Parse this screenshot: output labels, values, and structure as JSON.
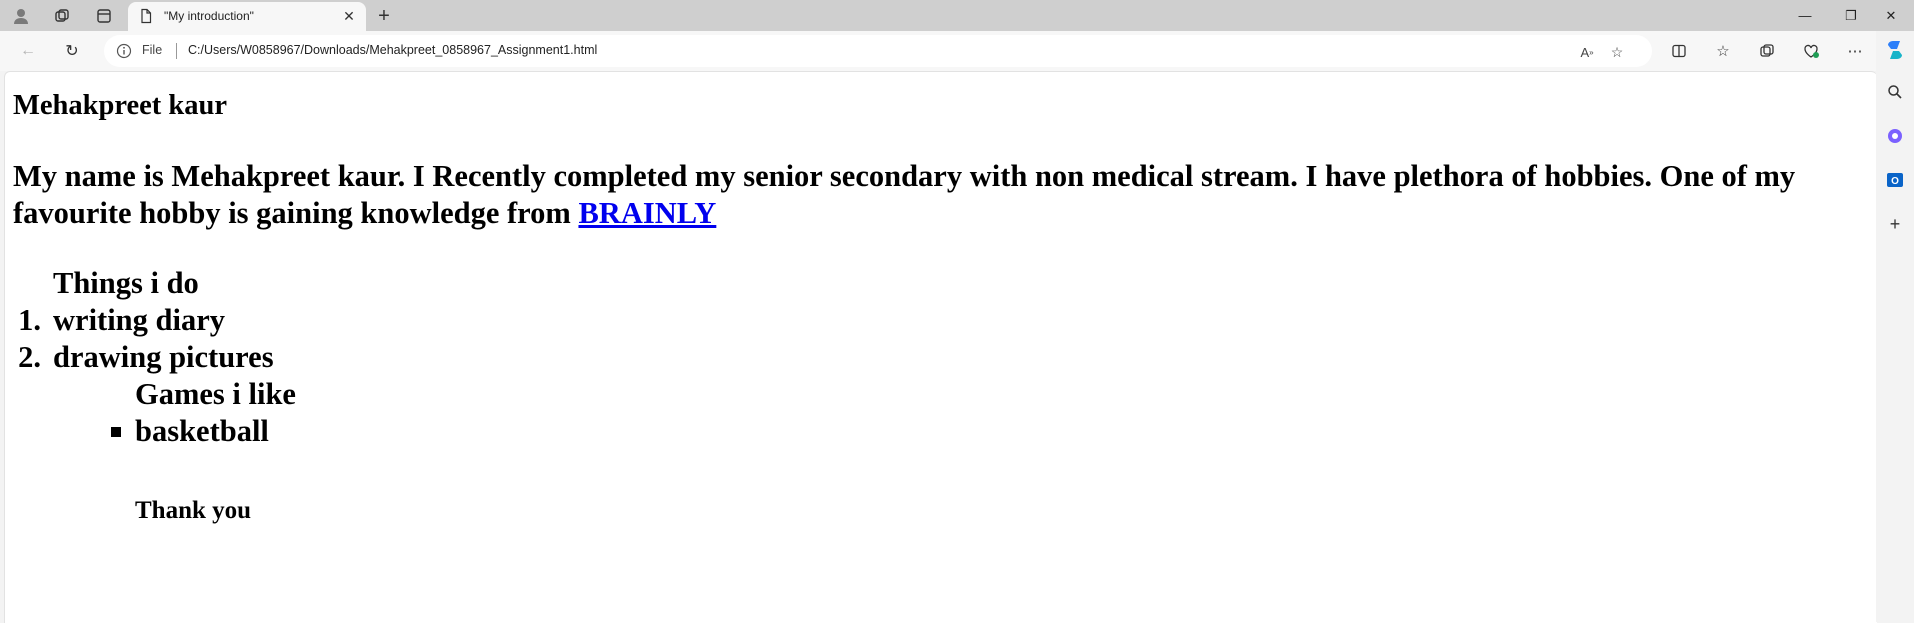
{
  "tab": {
    "title": "\"My introduction\""
  },
  "address": {
    "scheme_label": "File",
    "url": "C:/Users/W0858967/Downloads/Mehakpreet_0858967_Assignment1.html"
  },
  "page": {
    "heading": "Mehakpreet kaur",
    "intro_text": "My name is Mehakpreet kaur. I Recently completed my senior secondary with non medical stream. I have plethora of hobbies. One of my favourite hobby is gaining knowledge from ",
    "link_text": "BRAINLY",
    "things_heading": "Things i do",
    "things": [
      {
        "marker": "1.",
        "text": "writing diary"
      },
      {
        "marker": "2.",
        "text": "drawing pictures"
      }
    ],
    "games_heading": "Games i like",
    "games": [
      "basketball"
    ],
    "closing": "Thank you"
  },
  "icons": {
    "profile": "profile-icon",
    "workspaces": "workspaces-icon",
    "tab_actions": "tab-actions-icon",
    "page": "page-icon",
    "close": "close-icon",
    "new_tab": "plus-icon",
    "back": "back-arrow-icon",
    "refresh": "refresh-icon",
    "info": "info-icon",
    "read_aloud": "read-aloud-icon",
    "favorite": "star-icon",
    "split_screen": "split-screen-icon",
    "favorites": "favorites-icon",
    "collections": "collections-icon",
    "browser_essentials": "heart-pulse-icon",
    "more": "more-icon",
    "copilot": "copilot-icon",
    "search": "search-icon",
    "sidebar_app": "sidebar-app-icon",
    "outlook": "outlook-icon",
    "add": "plus-icon"
  },
  "colors": {
    "link": "#0000ee",
    "copilot": "#2d7ff9",
    "outlook": "#0a64c8"
  }
}
